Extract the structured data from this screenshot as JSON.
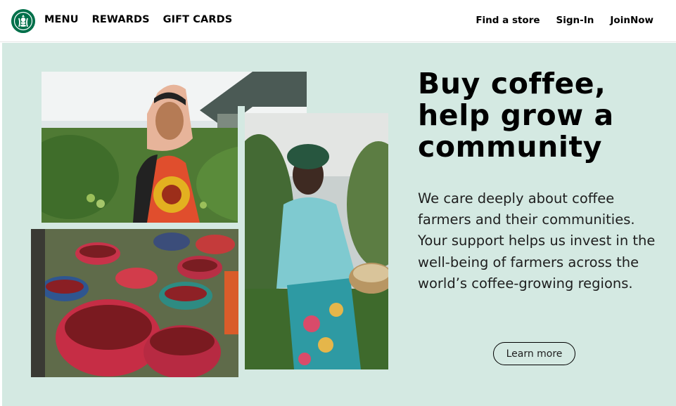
{
  "brand": {
    "logo": "starbucks-siren-logo",
    "color": "#00704A"
  },
  "nav": {
    "left": [
      "MENU",
      "REWARDS",
      "GIFT CARDS"
    ],
    "right": [
      "Find a store",
      "Sign-In",
      "JoinNow"
    ]
  },
  "hero": {
    "background": "#d4e9e2",
    "headline": "Buy coffee, help grow a community",
    "body": "We care deeply about coffee farmers and their communities. Your support helps us invest in the well-being of farmers across the world’s coffee-growing regions.",
    "cta_label": "Learn more"
  }
}
